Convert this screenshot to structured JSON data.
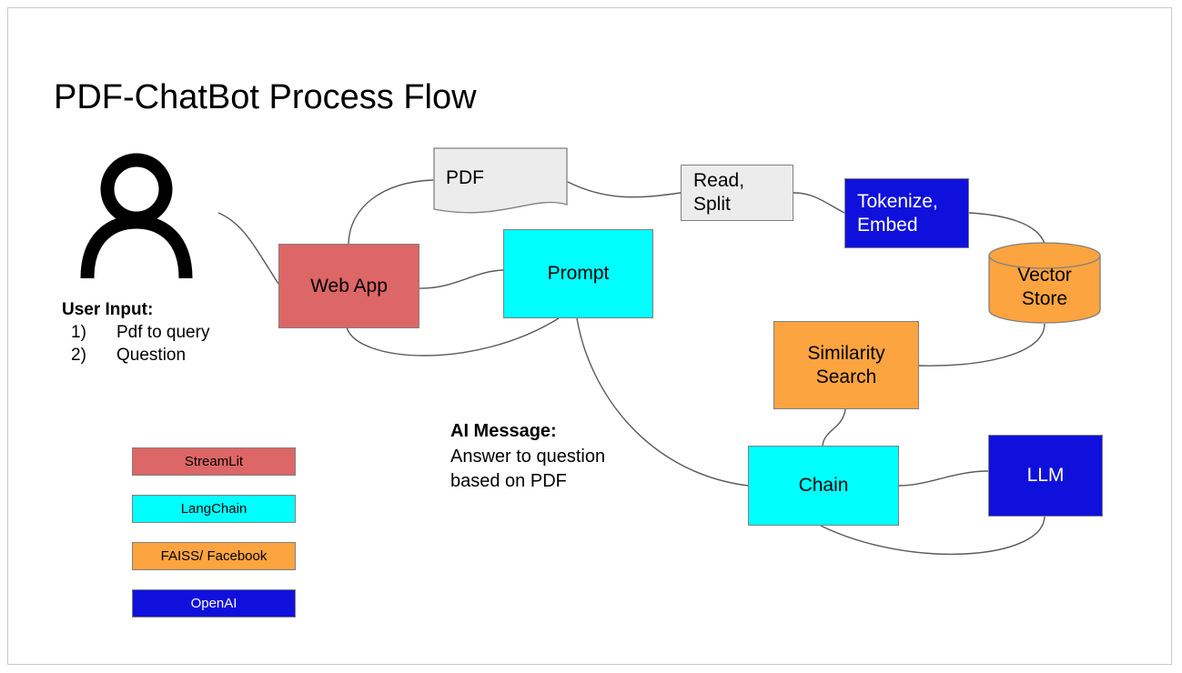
{
  "page": {
    "title": "PDF-ChatBot Process Flow"
  },
  "user": {
    "icon": "person-icon",
    "input_heading": "User Input:",
    "items": [
      {
        "num": "1)",
        "label": "Pdf to query"
      },
      {
        "num": "2)",
        "label": "Question"
      }
    ]
  },
  "ai_message": {
    "heading": "AI Message:",
    "line1": "Answer to question",
    "line2": "based on PDF"
  },
  "nodes": {
    "web_app": {
      "label": "Web App",
      "fill": "#DD6666",
      "text_color": "#000000"
    },
    "pdf": {
      "label": "PDF",
      "fill": "#ECECEC",
      "text_color": "#000000"
    },
    "read_split": {
      "label": "Read,\nSplit",
      "fill": "#ECECEC",
      "text_color": "#000000"
    },
    "tokenize_embed": {
      "label": "Tokenize,\nEmbed",
      "fill": "#1010DD",
      "text_color": "#FFFFFF"
    },
    "vector_store": {
      "label": "Vector\nStore",
      "fill": "#FCA43F",
      "text_color": "#000000"
    },
    "prompt": {
      "label": "Prompt",
      "fill": "#00FFFF",
      "text_color": "#000000"
    },
    "similarity": {
      "label": "Similarity\nSearch",
      "fill": "#FCA43F",
      "text_color": "#000000"
    },
    "chain": {
      "label": "Chain",
      "fill": "#00FFFF",
      "text_color": "#000000"
    },
    "llm": {
      "label": "LLM",
      "fill": "#1010DD",
      "text_color": "#FFFFFF"
    }
  },
  "legend": {
    "items": [
      {
        "label": "StreamLit",
        "fill": "#DD6666",
        "text_color": "#000000"
      },
      {
        "label": "LangChain",
        "fill": "#00FFFF",
        "text_color": "#000000"
      },
      {
        "label": "FAISS/ Facebook",
        "fill": "#FCA43F",
        "text_color": "#000000"
      },
      {
        "label": "OpenAI",
        "fill": "#1010DD",
        "text_color": "#FFFFFF"
      }
    ]
  },
  "edges": {
    "stroke": "#595959",
    "connections": [
      "user-to-web-app",
      "web-app-to-pdf",
      "pdf-to-read-split",
      "read-split-to-tokenize-embed",
      "tokenize-embed-to-vector-store",
      "web-app-to-prompt",
      "web-app-to-prompt-return",
      "prompt-to-chain",
      "vector-store-to-similarity-search",
      "similarity-search-to-chain",
      "chain-to-llm",
      "llm-to-chain-return"
    ]
  }
}
